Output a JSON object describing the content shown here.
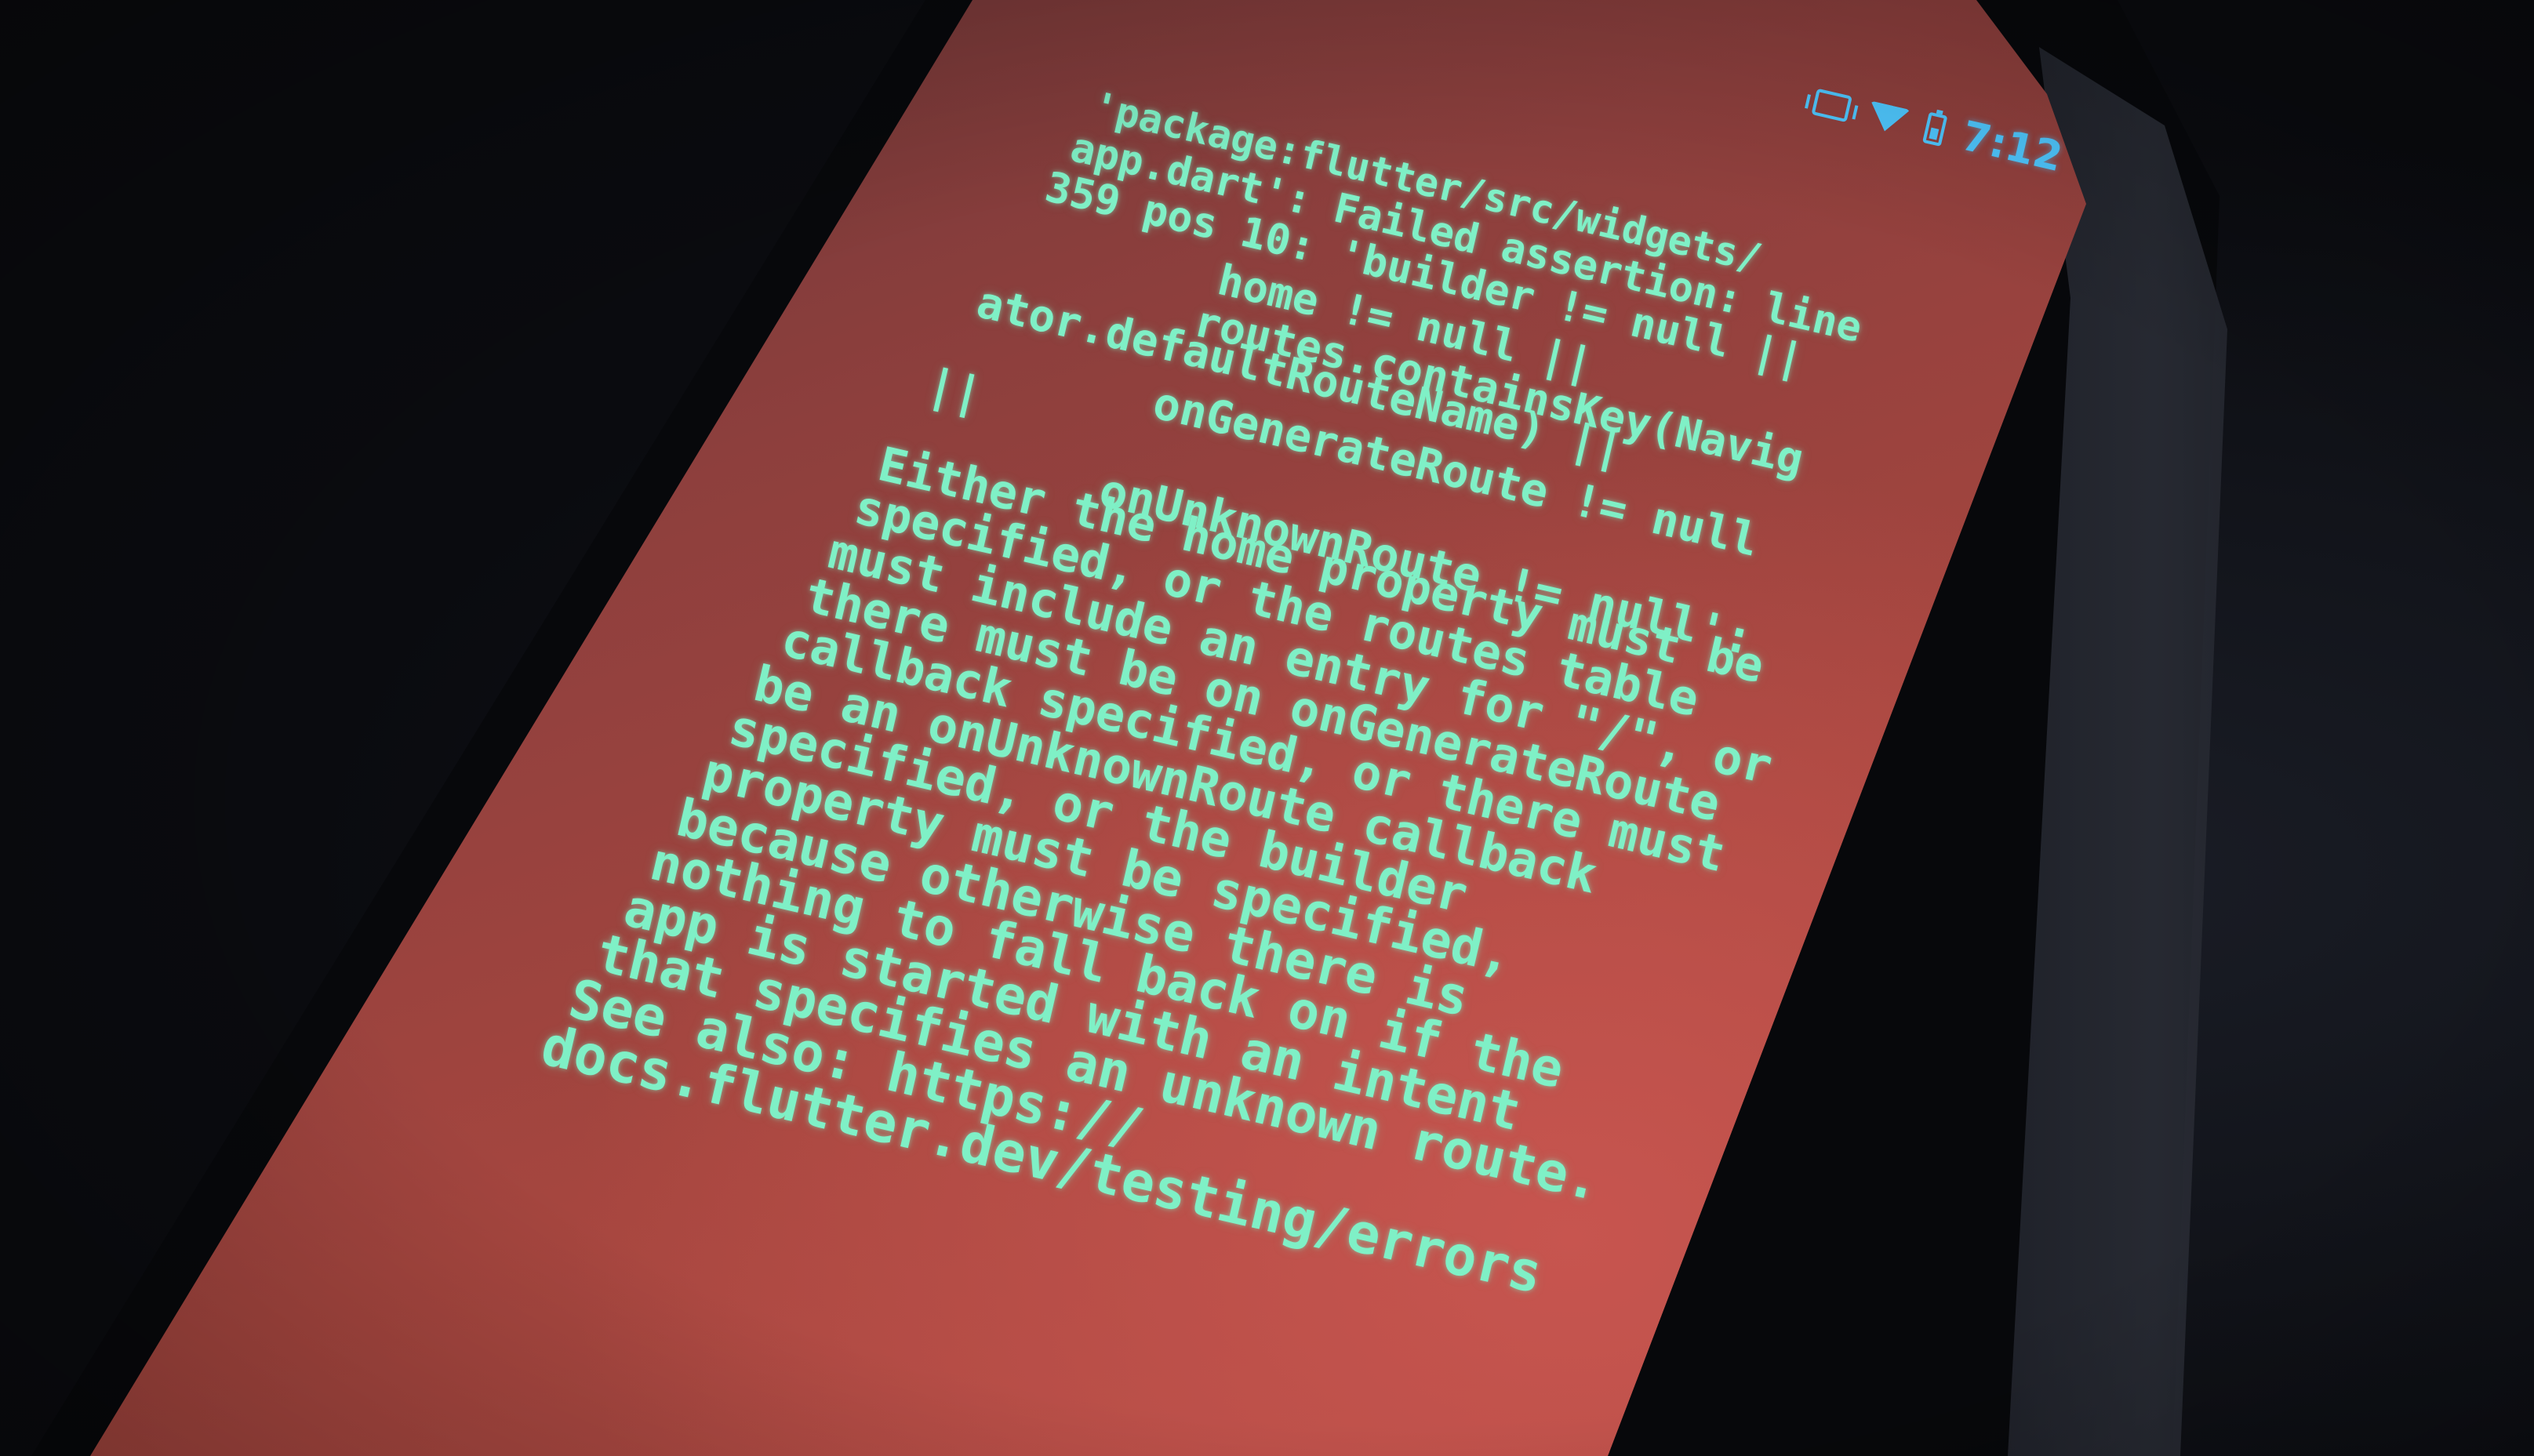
{
  "status_bar": {
    "icons": [
      "vibrate-icon",
      "wifi-icon",
      "battery-icon"
    ],
    "time": "7:12",
    "color": "#4fc8ff"
  },
  "error_screen": {
    "background_color": "#a6463f",
    "text_color": "#7ff0c6",
    "lines": [
      "'package:flutter/src/widgets/",
      "app.dart': Failed assertion: line",
      "359 pos 10: 'builder != null ||",
      "home != null ||",
      "routes.containsKey(Navig",
      "ator.defaultRouteName) ||",
      "onGenerateRoute != null",
      "||",
      "onUnknownRoute != null':",
      "Either the home property must be",
      "specified, or the routes table",
      "must include an entry for \"/\", or",
      "there must be on onGenerateRoute",
      "callback specified, or there must",
      "be an onUnknownRoute callback",
      "specified, or the builder",
      "property must be specified,",
      "because otherwise there is",
      "nothing to fall back on if the",
      "app is started with an intent",
      "that specifies an unknown route.",
      "See also: https://",
      "docs.flutter.dev/testing/errors"
    ]
  }
}
